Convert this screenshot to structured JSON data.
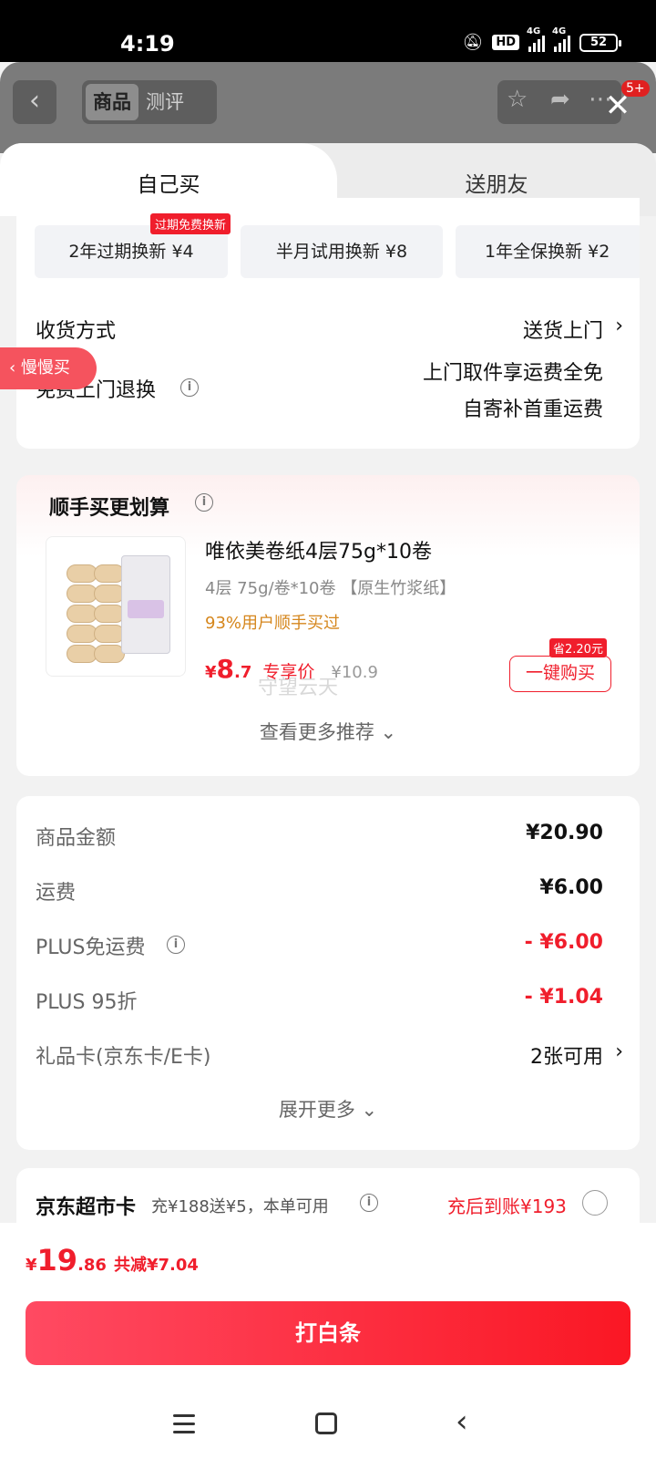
{
  "status_bar": {
    "time": "4:19",
    "hd": "HD",
    "net1": "4G",
    "net2": "4G",
    "battery": "52"
  },
  "top_bar": {
    "tabs": [
      "商品",
      "测评"
    ],
    "badge": "5+"
  },
  "sheet_tabs": {
    "self": "自己买",
    "friend": "送朋友"
  },
  "services": {
    "items": [
      "2年过期换新  ¥4",
      "半月试用换新  ¥8",
      "1年全保换新  ¥2"
    ],
    "tag": "过期免费换新",
    "delivery_label": "收货方式",
    "delivery_value": "送货上门",
    "return_label": "免费上门退换",
    "return_line1": "上门取件享运费全免",
    "return_line2": "自寄补首重运费"
  },
  "recommend": {
    "slow_tag": "慢慢买",
    "title": "顺手买更划算",
    "product_name": "唯依美卷纸4层75g*10卷",
    "product_spec": "4层 75g/卷*10卷 【原生竹浆纸】",
    "popularity": "93%用户顺手买过",
    "price_symbol": "¥",
    "price_int": "8",
    "price_dec": ".7",
    "price_label": "专享价",
    "orig_price": "¥10.9",
    "save_tag": "省2.20元",
    "buy_button": "一键购买",
    "more": "查看更多推荐 ⌄",
    "watermark": "守望云天"
  },
  "price_detail": {
    "rows": [
      {
        "label": "商品金额",
        "value": "¥20.90"
      },
      {
        "label": "运费",
        "value": "¥6.00"
      },
      {
        "label": "PLUS免运费",
        "value": "- ¥6.00"
      },
      {
        "label": "PLUS 95折",
        "value": "- ¥1.04"
      },
      {
        "label": "礼品卡(京东卡/E卡)",
        "value": "2张可用"
      }
    ],
    "expand": "展开更多 ⌄"
  },
  "jd_card": {
    "title": "京东超市卡",
    "desc": "充¥188送¥5，本单可用",
    "return": "充后到账¥193"
  },
  "bottom": {
    "total_symbol": "¥",
    "total_int": "19",
    "total_dec": ".86",
    "total_save": "共减¥7.04",
    "pay_button": "打白条"
  },
  "colors": {
    "accent": "#f01e2c",
    "pay_gradient_start": "#ff4a62",
    "pay_gradient_end": "#fa1724",
    "popularity": "#d5861c"
  }
}
